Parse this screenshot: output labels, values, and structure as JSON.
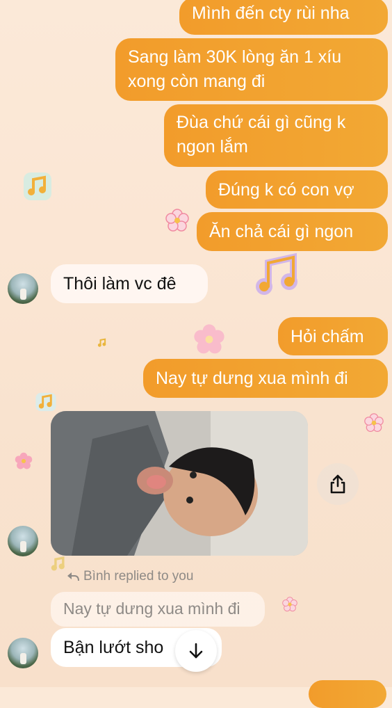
{
  "messages_out": [
    {
      "text": "Mình đến cty rùi nha"
    },
    {
      "text": "Sang làm 30K lòng ăn 1 xíu"
    },
    {
      "text": "xong còn mang đi"
    },
    {
      "text": "Đùa chứ cái gì cũng k"
    },
    {
      "text": "ngon lắm"
    },
    {
      "text": "Đúng k có con vợ"
    },
    {
      "text": "Ăn chả cái gì ngon"
    },
    {
      "text": "Hỏi chấm"
    },
    {
      "text": "Nay tự dưng xua mình đi"
    }
  ],
  "messages_in": [
    {
      "text": "Thôi làm vc đê"
    },
    {
      "text": "Bận lướt sho"
    }
  ],
  "reply": {
    "meta": "Bình replied to you",
    "quote": "Nay tự dưng xua mình đi"
  },
  "colors": {
    "outgoing_bubble": "#f29c2b",
    "incoming_bubble": "#fff6f1",
    "background": "#fbe9d8"
  },
  "icons": [
    "music-note-icon",
    "flower-icon",
    "share-icon",
    "reply-arrow-icon",
    "arrow-down-icon"
  ]
}
